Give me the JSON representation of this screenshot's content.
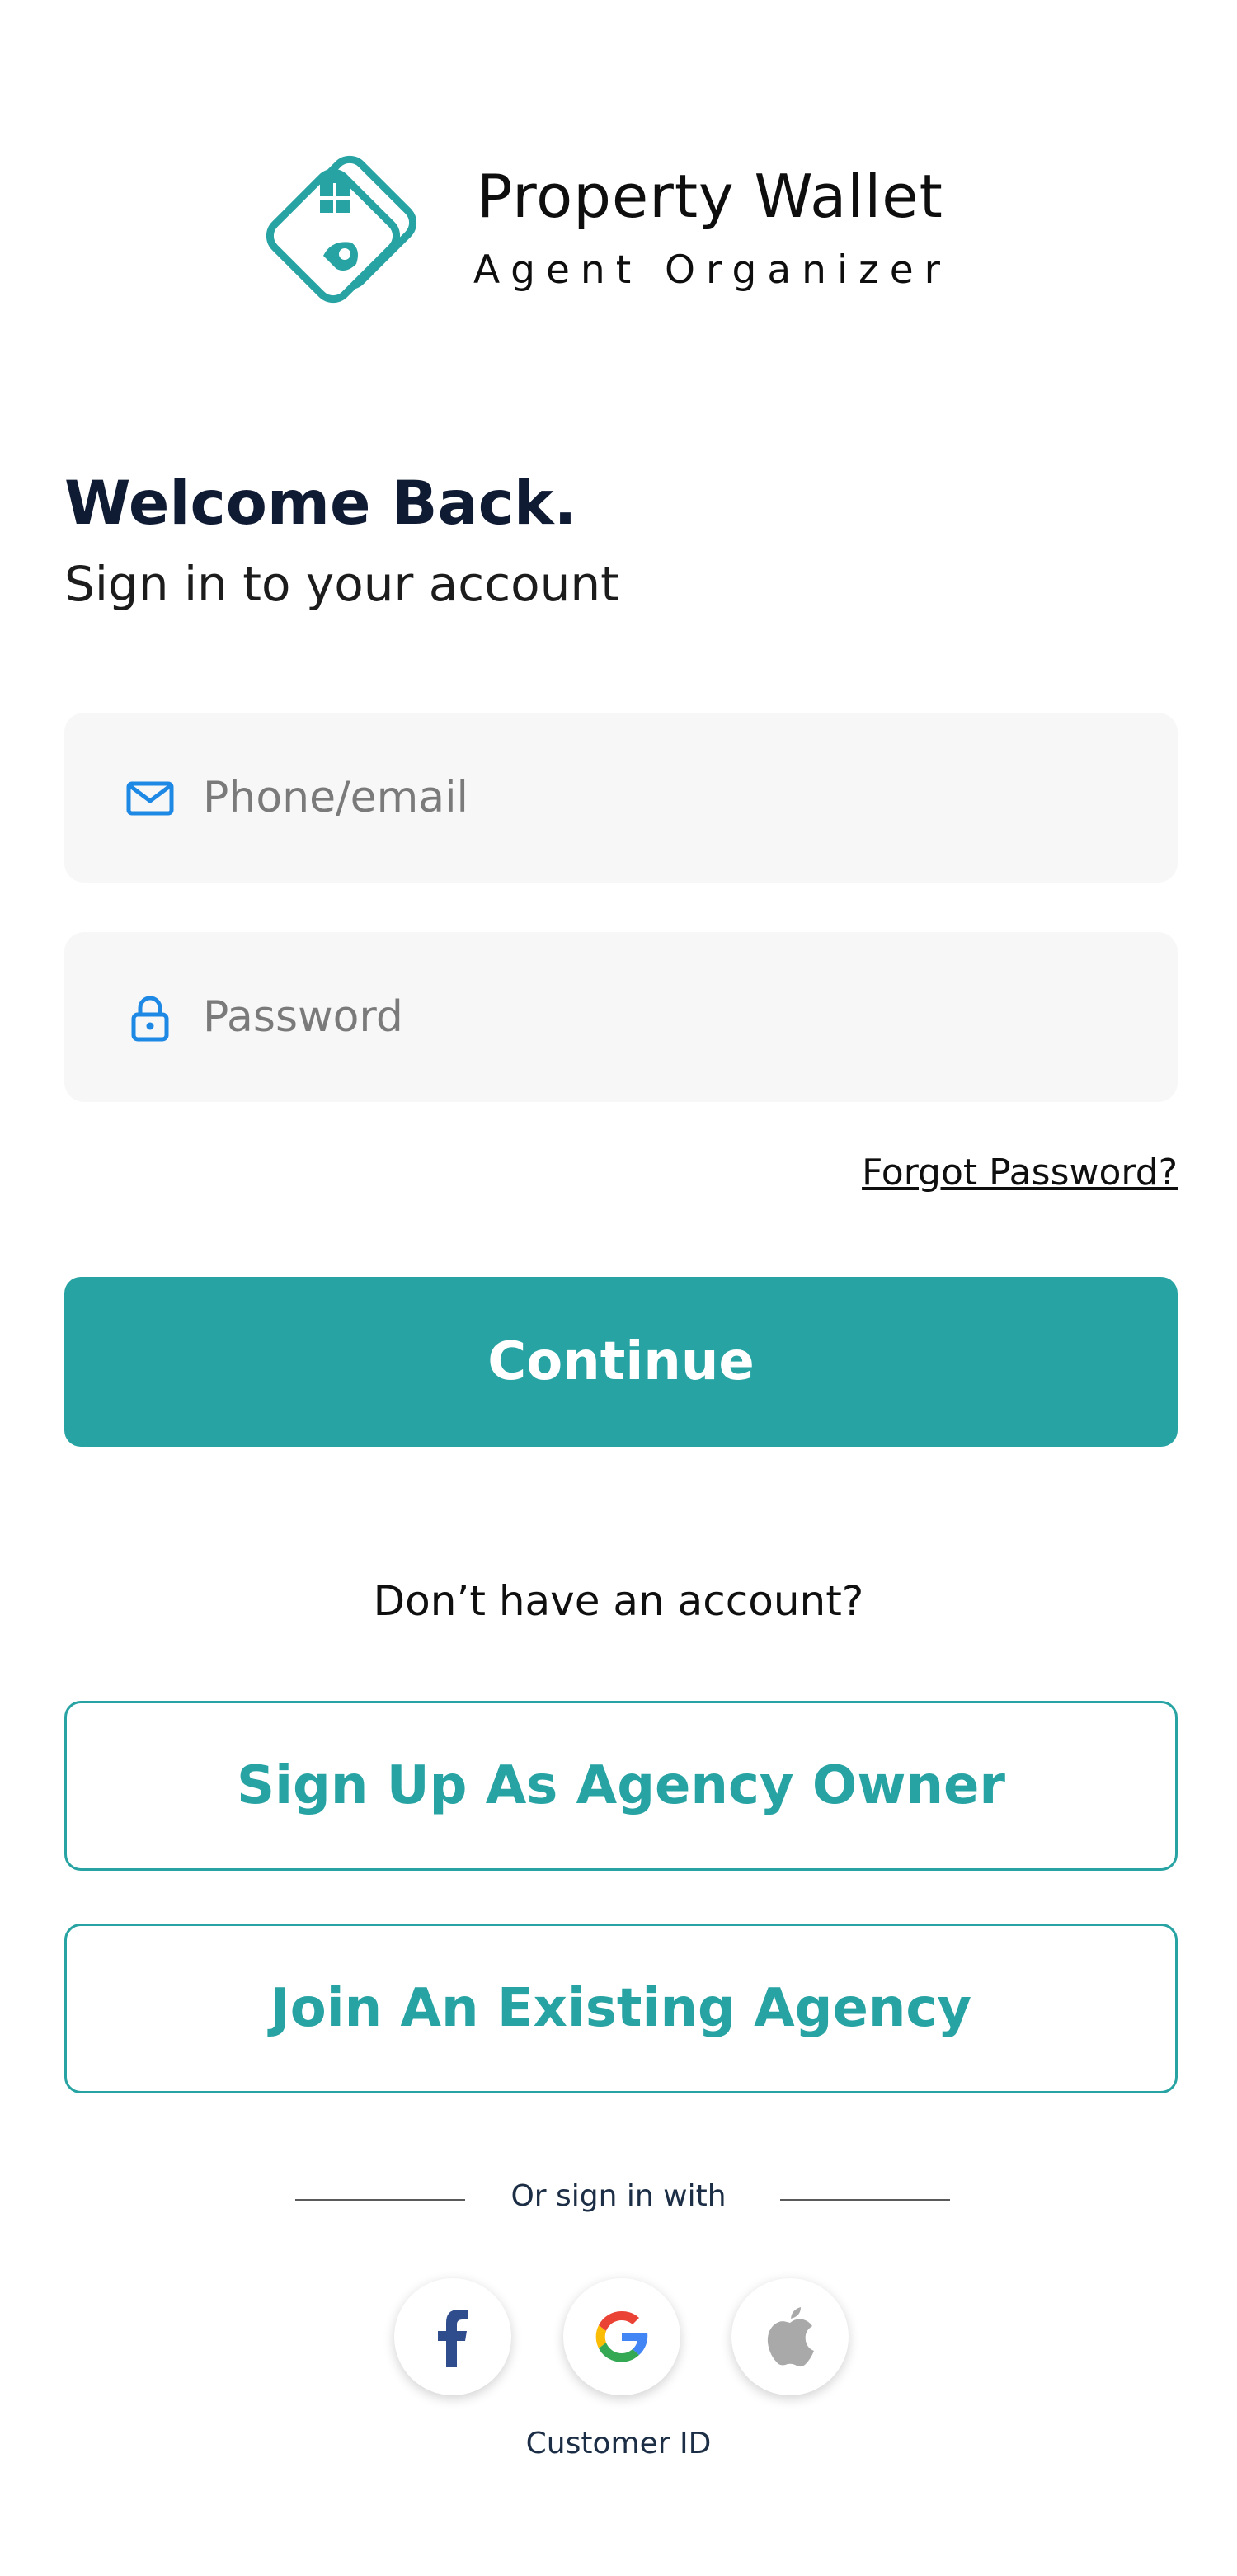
{
  "brand": {
    "name": "Property Wallet",
    "tagline": "Agent Organizer",
    "accent_color": "#26a3a2"
  },
  "welcome": {
    "title": "Welcome Back.",
    "subtitle": "Sign in to your account"
  },
  "form": {
    "email_placeholder": "Phone/email",
    "email_icon": "mail-icon",
    "password_placeholder": "Password",
    "password_icon": "lock-icon",
    "forgot_label": "Forgot Password?",
    "continue_label": "Continue"
  },
  "signup": {
    "prompt": "Don’t have an account?",
    "agency_owner_label": "Sign Up As Agency Owner",
    "join_agency_label": "Join An Existing Agency"
  },
  "social": {
    "divider_text": "Or sign in with",
    "providers": [
      {
        "icon": "facebook-icon"
      },
      {
        "icon": "google-icon"
      },
      {
        "icon": "apple-icon"
      }
    ],
    "customer_id_label": "Customer ID"
  }
}
